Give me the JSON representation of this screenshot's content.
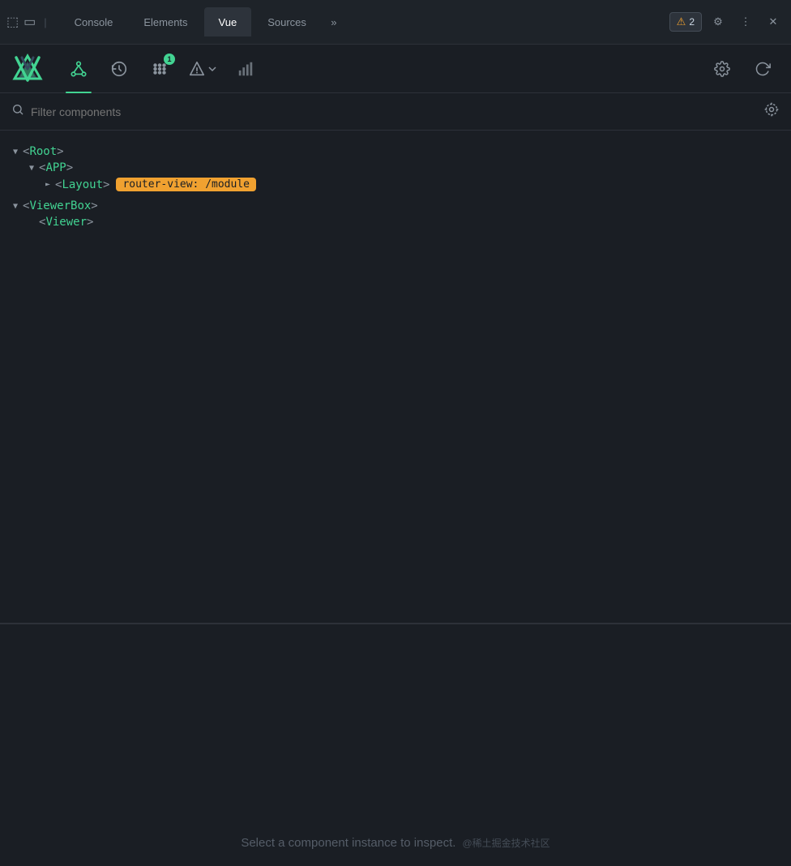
{
  "tabs": {
    "items": [
      {
        "label": "Console",
        "active": false
      },
      {
        "label": "Elements",
        "active": false
      },
      {
        "label": "Vue",
        "active": true
      },
      {
        "label": "Sources",
        "active": false
      }
    ],
    "more_label": "»",
    "warning_count": "2",
    "settings_label": "⚙",
    "dots_label": "⋮",
    "close_label": "✕"
  },
  "devtools": {
    "nav_items": [
      {
        "id": "components",
        "icon": "⑂",
        "active": true
      },
      {
        "id": "history",
        "icon": "⏱"
      },
      {
        "id": "events",
        "icon": "⠿",
        "badge": "1"
      },
      {
        "id": "router",
        "icon": "◈",
        "has_dropdown": true
      },
      {
        "id": "performance",
        "icon": "▊"
      }
    ],
    "nav_right": [
      {
        "id": "settings",
        "icon": "⚙"
      },
      {
        "id": "refresh",
        "icon": "↺"
      }
    ]
  },
  "filter": {
    "placeholder": "Filter components"
  },
  "tree": {
    "items": [
      {
        "indent": 0,
        "arrow": "▼",
        "tag": "Root",
        "badge": null
      },
      {
        "indent": 1,
        "arrow": "▼",
        "tag": "APP",
        "badge": null
      },
      {
        "indent": 2,
        "arrow": "►",
        "tag": "Layout",
        "badge": "router-view: /module"
      },
      {
        "indent": 0,
        "arrow": "▼",
        "tag": "ViewerBox",
        "badge": null
      },
      {
        "indent": 1,
        "arrow": null,
        "tag": "Viewer",
        "badge": null
      }
    ]
  },
  "bottom": {
    "select_text": "Select a component instance to inspect.",
    "credit_text": "@稀土掘金技术社区"
  }
}
